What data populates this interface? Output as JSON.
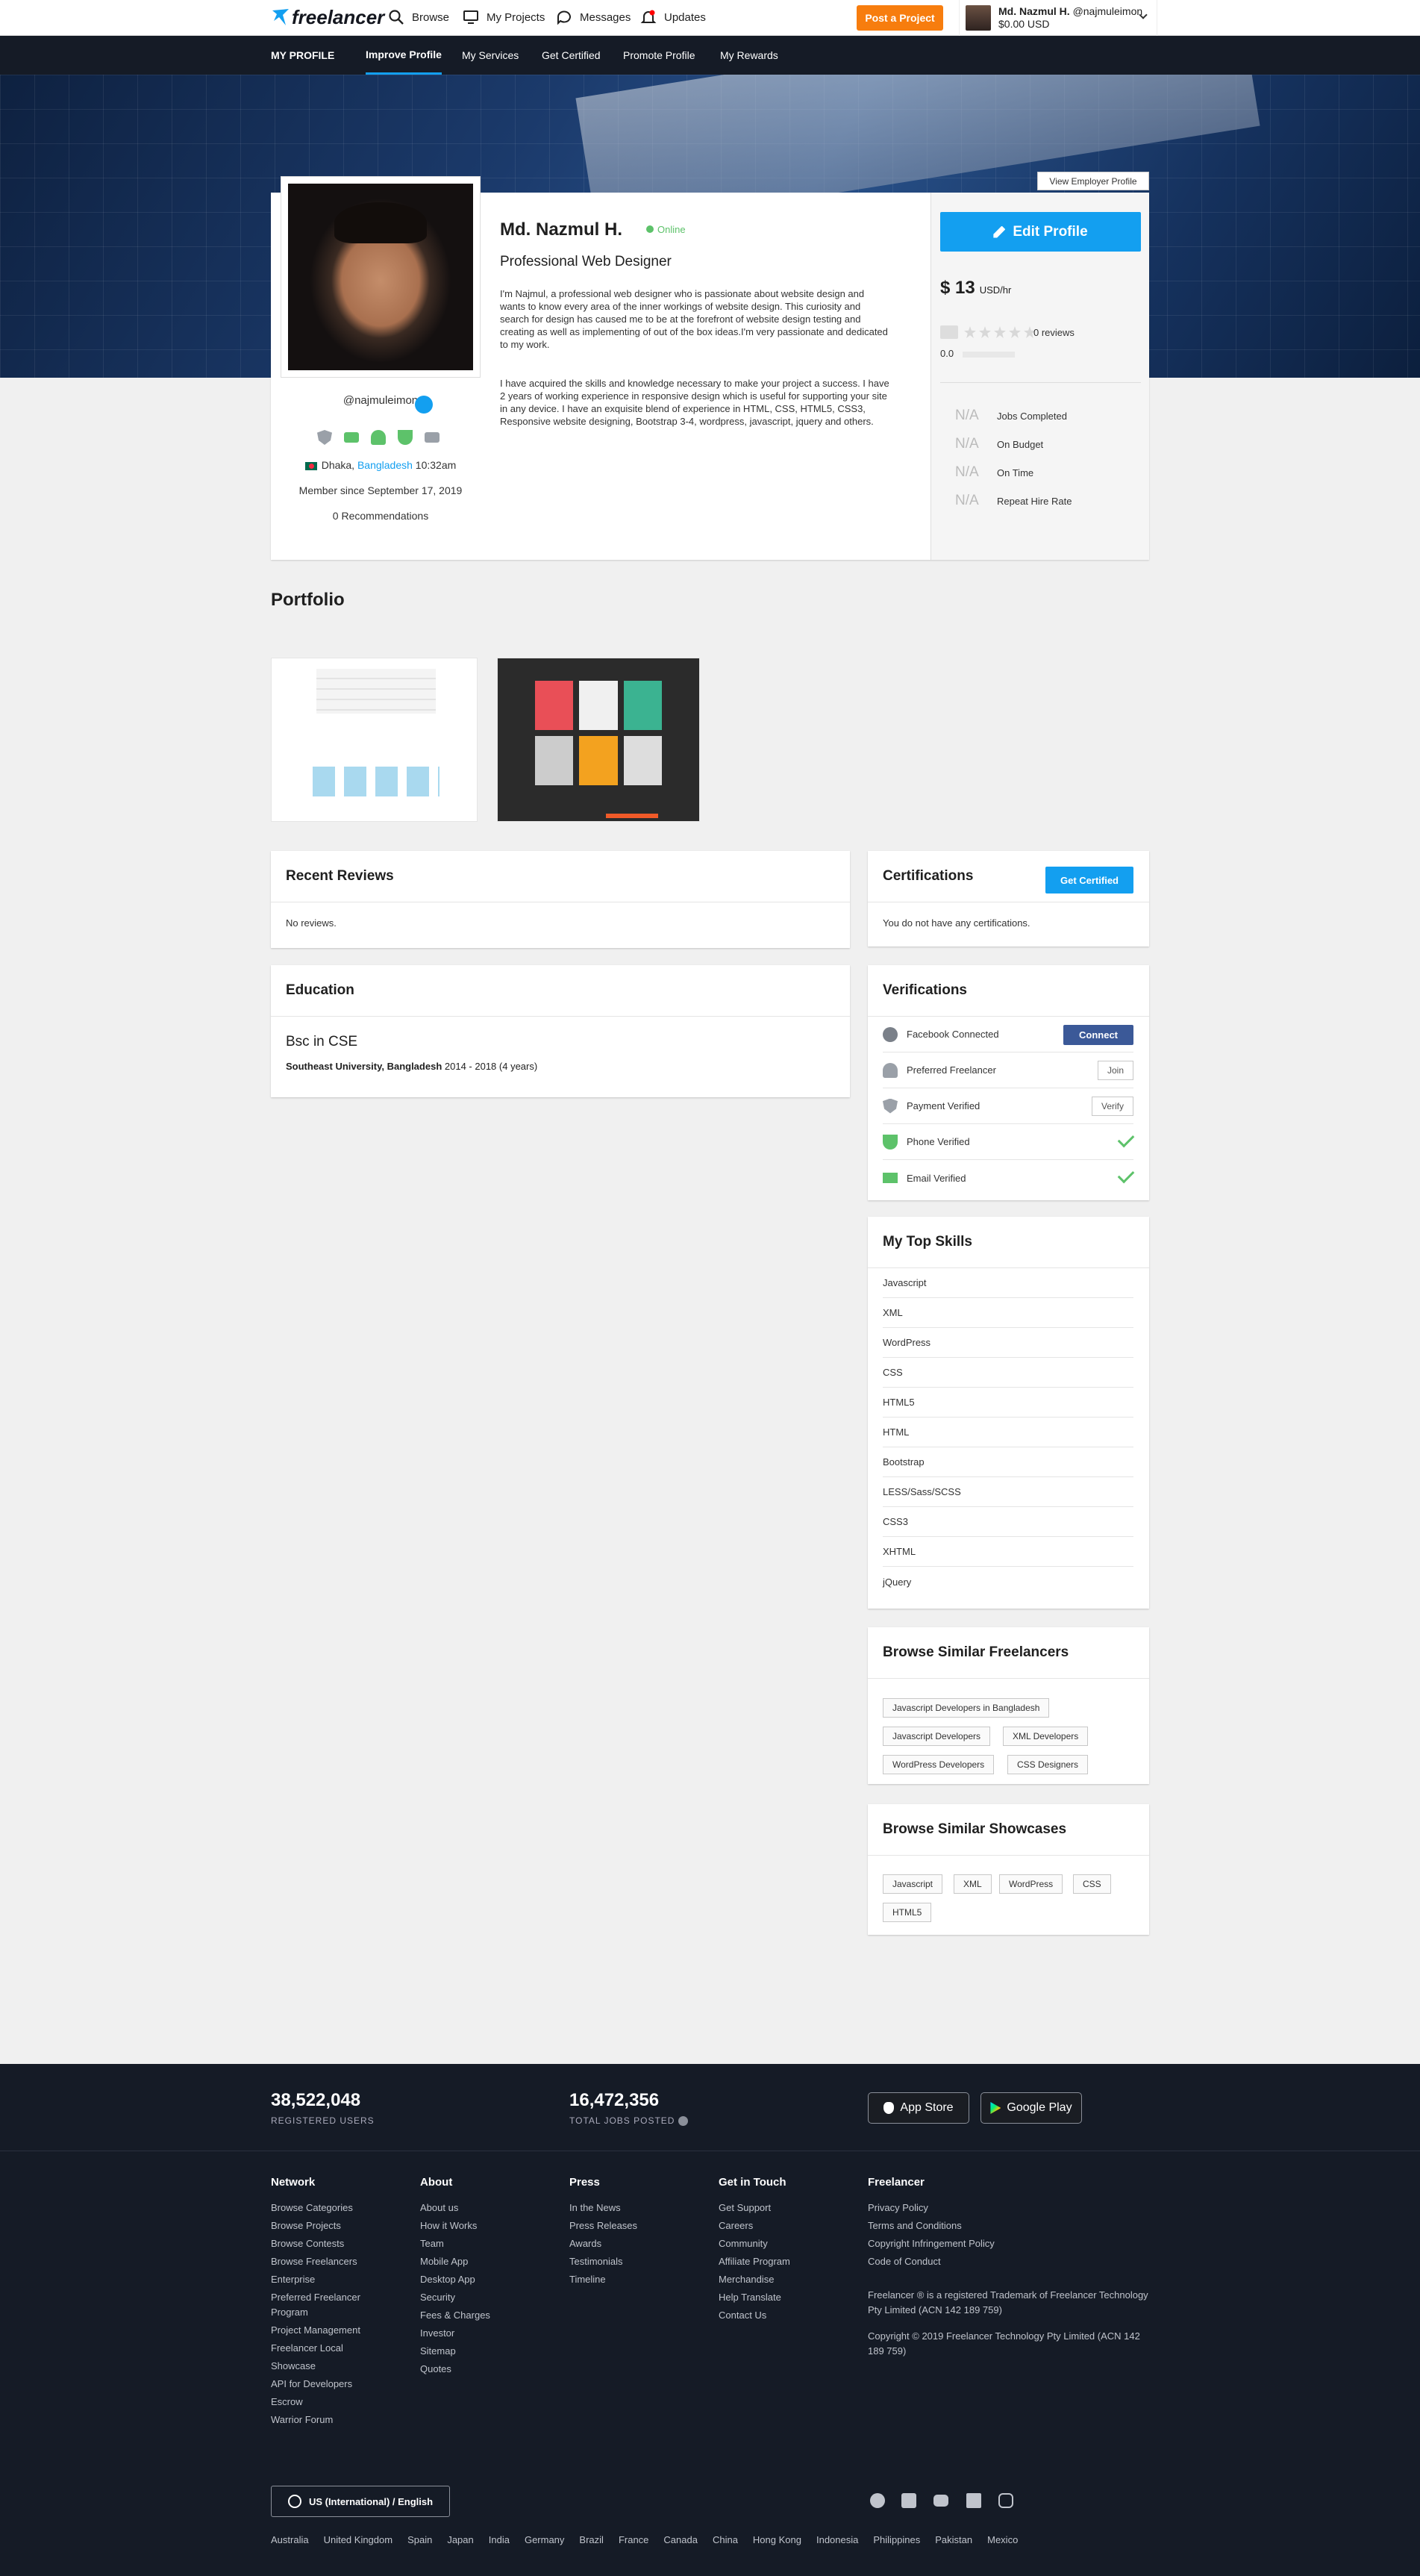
{
  "topbar": {
    "logo": "freelancer",
    "browse": "Browse",
    "my_projects": "My Projects",
    "messages": "Messages",
    "updates": "Updates",
    "post_project": "Post a Project",
    "user_name": "Md. Nazmul H.",
    "user_handle": "@najmuleimon",
    "balance": "$0.00 USD"
  },
  "subnav": {
    "title": "MY PROFILE",
    "items": [
      "Improve Profile",
      "My Services",
      "Get Certified",
      "Promote Profile",
      "My Rewards"
    ]
  },
  "hero": {
    "view_employer": "View Employer Profile"
  },
  "profile": {
    "username": "@najmuleimon",
    "city": "Dhaka,",
    "country": "Bangladesh",
    "local_time": "10:32am",
    "member_since": "Member since September 17, 2019",
    "recommendations": "0 Recommendations",
    "name": "Md. Nazmul H.",
    "status": "Online",
    "headline": "Professional Web Designer",
    "bio1": "I'm Najmul, a professional web designer who is passionate about website design and wants to know every area of the inner workings of website design. This curiosity and search for design has caused me to be at the forefront of website design testing and creating as well as implementing of out of the box ideas.I'm very passionate and dedicated to my work.",
    "bio2": "I have acquired the skills and knowledge necessary to make your project a success. I have 2 years of working experience in responsive design which is useful for supporting your site in any device. I have an exquisite blend of experience in HTML, CSS, HTML5, CSS3, Responsive website designing, Bootstrap 3-4, wordpress, javascript, jquery and others.",
    "edit_profile": "Edit Profile",
    "rate": "$ 13",
    "rate_unit": "USD/hr",
    "reviews": "0 reviews",
    "score": "0.0",
    "stats": [
      {
        "value": "N/A",
        "label": "Jobs Completed"
      },
      {
        "value": "N/A",
        "label": "On Budget"
      },
      {
        "value": "N/A",
        "label": "On Time"
      },
      {
        "value": "N/A",
        "label": "Repeat Hire Rate"
      }
    ]
  },
  "portfolio": {
    "heading": "Portfolio"
  },
  "reviews": {
    "heading": "Recent Reviews",
    "empty": "No reviews."
  },
  "education": {
    "heading": "Education",
    "degree": "Bsc in CSE",
    "school": "Southeast University, Bangladesh",
    "years": "2014 - 2018 (4 years)"
  },
  "certifications": {
    "heading": "Certifications",
    "button": "Get Certified",
    "empty": "You do not have any certifications."
  },
  "verifications": {
    "heading": "Verifications",
    "items": [
      {
        "label": "Facebook Connected",
        "action": "Connect"
      },
      {
        "label": "Preferred Freelancer",
        "action": "Join"
      },
      {
        "label": "Payment Verified",
        "action": "Verify"
      },
      {
        "label": "Phone Verified"
      },
      {
        "label": "Email Verified"
      }
    ]
  },
  "skills": {
    "heading": "My Top Skills",
    "items": [
      "Javascript",
      "XML",
      "WordPress",
      "CSS",
      "HTML5",
      "HTML",
      "Bootstrap",
      "LESS/Sass/SCSS",
      "CSS3",
      "XHTML",
      "jQuery"
    ]
  },
  "similar_freelancers": {
    "heading": "Browse Similar Freelancers",
    "chips": [
      "Javascript Developers in Bangladesh",
      "Javascript Developers",
      "XML Developers",
      "WordPress Developers",
      "CSS Designers"
    ]
  },
  "similar_showcases": {
    "heading": "Browse Similar Showcases",
    "chips": [
      "Javascript",
      "XML",
      "WordPress",
      "CSS",
      "HTML5"
    ]
  },
  "footer": {
    "users": "38,522,048",
    "users_label": "REGISTERED USERS",
    "jobs": "16,472,356",
    "jobs_label": "TOTAL JOBS POSTED",
    "app_store": "App Store",
    "google_play": "Google Play",
    "network": {
      "heading": "Network",
      "links": [
        "Browse Categories",
        "Browse Projects",
        "Browse Contests",
        "Browse Freelancers",
        "Enterprise",
        "Preferred Freelancer Program",
        "Project Management",
        "Freelancer Local",
        "Showcase",
        "API for Developers",
        "Escrow",
        "Warrior Forum"
      ]
    },
    "about": {
      "heading": "About",
      "links": [
        "About us",
        "How it Works",
        "Team",
        "Mobile App",
        "Desktop App",
        "Security",
        "Fees & Charges",
        "Investor",
        "Sitemap",
        "Quotes"
      ]
    },
    "press": {
      "heading": "Press",
      "links": [
        "In the News",
        "Press Releases",
        "Awards",
        "Testimonials",
        "Timeline"
      ]
    },
    "contact": {
      "heading": "Get in Touch",
      "links": [
        "Get Support",
        "Careers",
        "Community",
        "Affiliate Program",
        "Merchandise",
        "Help Translate",
        "Contact Us"
      ]
    },
    "freelancer": {
      "heading": "Freelancer",
      "links": [
        "Privacy Policy",
        "Terms and Conditions",
        "Copyright Infringement Policy",
        "Code of Conduct"
      ]
    },
    "trademark": "Freelancer ® is a registered Trademark of Freelancer Technology Pty Limited (ACN 142 189 759)",
    "copyright": "Copyright © 2019 Freelancer Technology Pty Limited (ACN 142 189 759)",
    "language": "US (International) / English",
    "countries": [
      "Australia",
      "United Kingdom",
      "Spain",
      "Japan",
      "India",
      "Germany",
      "Brazil",
      "France",
      "Canada",
      "China",
      "Hong Kong",
      "Indonesia",
      "Philippines",
      "Pakistan",
      "Mexico"
    ]
  }
}
